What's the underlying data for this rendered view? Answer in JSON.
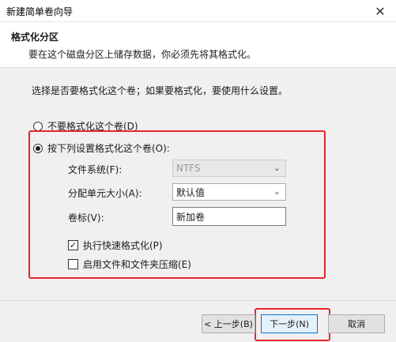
{
  "window": {
    "title": "新建简单卷向导",
    "close_glyph": "✕"
  },
  "header": {
    "title": "格式化分区",
    "subtitle": "要在这个磁盘分区上储存数据，你必须先将其格式化。"
  },
  "body": {
    "instruction": "选择是否要格式化这个卷；如果要格式化，要使用什么设置。",
    "options": {
      "no_format": {
        "label": "不要格式化这个卷(D)",
        "checked": false
      },
      "format": {
        "label": "按下列设置格式化这个卷(O):",
        "checked": true
      }
    },
    "file_system": {
      "label": "文件系统(F):",
      "value": "NTFS"
    },
    "allocation_unit": {
      "label": "分配单元大小(A):",
      "value": "默认值"
    },
    "volume_label": {
      "label": "卷标(V):",
      "value": "新加卷"
    },
    "quick_format": {
      "label": "执行快速格式化(P)",
      "checked": true,
      "check_glyph": "✓"
    },
    "compression": {
      "label": "启用文件和文件夹压缩(E)",
      "checked": false
    }
  },
  "buttons": {
    "back": "< 上一步(B)",
    "next": "下一步(N)",
    "cancel": "取消"
  },
  "colors": {
    "highlight": "#e8262b",
    "default_button_border": "#0078d7"
  }
}
